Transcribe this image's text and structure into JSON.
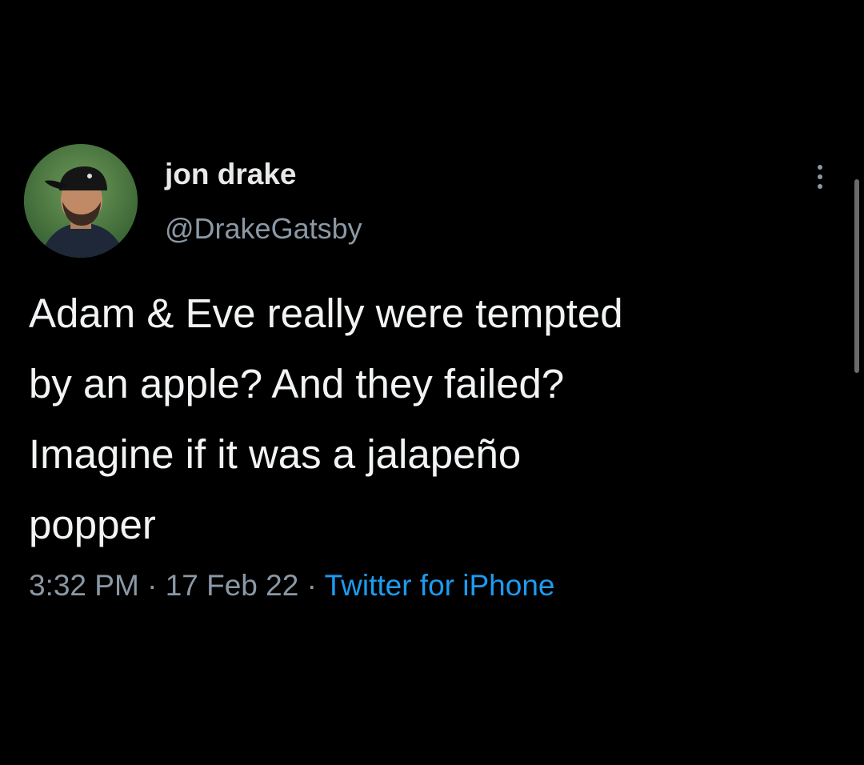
{
  "tweet": {
    "author": {
      "display_name": "jon drake",
      "handle": "@DrakeGatsby",
      "avatar": "avatar-icon"
    },
    "text_lines": [
      "Adam & Eve really were tempted",
      "by an apple? And they failed?",
      "Imagine if it was a jalapeño",
      "popper"
    ],
    "time": "3:32 PM",
    "separator": "·",
    "date": "17 Feb 22",
    "source": "Twitter for iPhone",
    "more_icon": "more-vertical-icon"
  },
  "colors": {
    "background": "#000000",
    "primary_text": "#e7e9ea",
    "secondary_text": "#8b98a5",
    "link": "#1d9bf0"
  }
}
